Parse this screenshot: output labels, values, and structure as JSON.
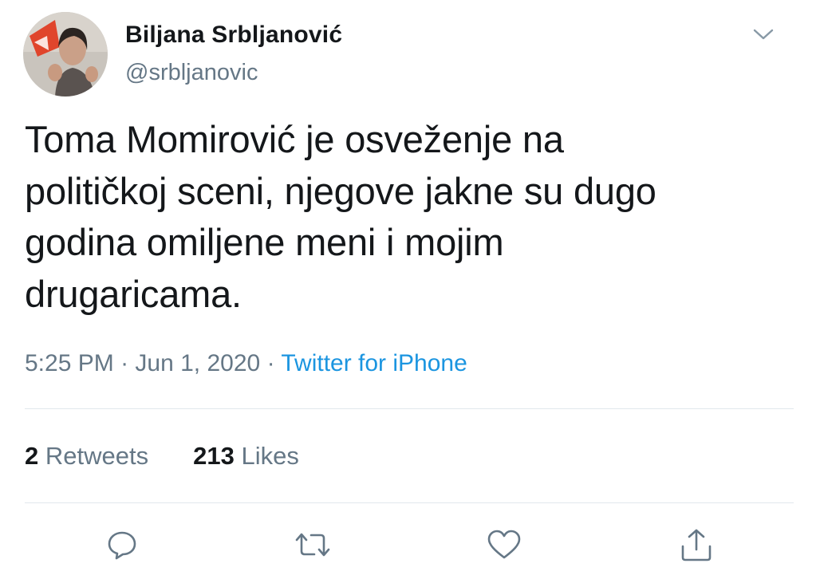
{
  "tweet": {
    "author": {
      "display_name": "Biljana Srbljanović",
      "handle": "@srbljanovic",
      "avatar_icon": "profile-photo-avatar"
    },
    "menu_icon": "chevron-down-icon",
    "text": "Toma Momirović je osveženje na\npolitičkoj sceni, njegove jakne su dugo\ngodina omiljene meni i mojim\ndrugaricama.",
    "time": "5:25 PM",
    "separator": "·",
    "date": "Jun 1, 2020",
    "source": "Twitter for iPhone",
    "stats": {
      "retweets_count": "2",
      "retweets_label": "Retweets",
      "likes_count": "213",
      "likes_label": "Likes"
    },
    "actions": {
      "reply_icon": "reply-icon",
      "retweet_icon": "retweet-icon",
      "like_icon": "heart-icon",
      "share_icon": "share-icon"
    }
  },
  "colors": {
    "text_primary": "#14171a",
    "text_secondary": "#657786",
    "link": "#1b95e0",
    "divider": "#e1e8ed",
    "icon": "#657786"
  }
}
